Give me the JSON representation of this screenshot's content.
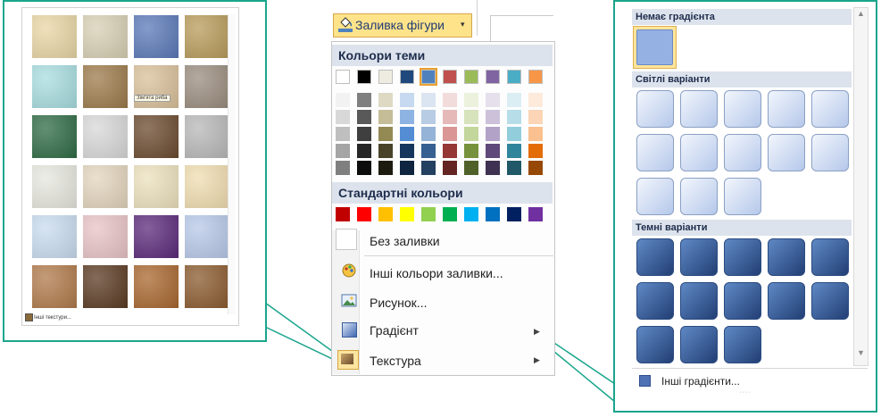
{
  "fill_button": {
    "label": "Заливка фігури",
    "arrow": "▾",
    "icon": "paint-bucket-icon"
  },
  "menu": {
    "theme_colors_header": "Кольори теми",
    "standard_colors_header": "Стандартні кольори",
    "items": [
      {
        "label": "Без заливки",
        "icon": "no-fill-icon",
        "submenu": false
      },
      {
        "label": "Інші кольори заливки...",
        "icon": "palette-icon",
        "submenu": false
      },
      {
        "label": "Рисунок...",
        "icon": "picture-icon",
        "submenu": false
      },
      {
        "label": "Градієнт",
        "icon": "gradient-icon",
        "submenu": true
      },
      {
        "label": "Текстура",
        "icon": "texture-icon",
        "submenu": true
      }
    ],
    "submenu_arrow": "▶",
    "theme_top_row": [
      "#ffffff",
      "#000000",
      "#eeece1",
      "#1f497d",
      "#4f81bd",
      "#c0504d",
      "#9bbb59",
      "#8064a2",
      "#4bacc6",
      "#f79646"
    ],
    "theme_shades": [
      [
        "#f2f2f2",
        "#d8d8d8",
        "#bfbfbf",
        "#a5a5a5",
        "#7f7f7f"
      ],
      [
        "#7f7f7f",
        "#595959",
        "#3f3f3f",
        "#262626",
        "#0c0c0c"
      ],
      [
        "#ddd9c3",
        "#c4bd97",
        "#938953",
        "#494429",
        "#1d1b10"
      ],
      [
        "#c6d9f0",
        "#8db3e2",
        "#548dd4",
        "#17365d",
        "#0f243e"
      ],
      [
        "#dbe5f1",
        "#b8cce4",
        "#95b3d7",
        "#366092",
        "#244061"
      ],
      [
        "#f2dcdb",
        "#e5b9b7",
        "#d99694",
        "#953734",
        "#632423"
      ],
      [
        "#ebf1dd",
        "#d7e3bc",
        "#c3d69b",
        "#76923c",
        "#4f6128"
      ],
      [
        "#e5e0ec",
        "#ccc1d9",
        "#b2a2c7",
        "#5f497a",
        "#3f3151"
      ],
      [
        "#dbeef3",
        "#b7dde8",
        "#92cddc",
        "#31859b",
        "#205867"
      ],
      [
        "#fdeada",
        "#fbd5b5",
        "#fac08f",
        "#e36c09",
        "#974806"
      ]
    ],
    "standard_colors": [
      "#c00000",
      "#ff0000",
      "#ffc000",
      "#ffff00",
      "#92d050",
      "#00b050",
      "#00b0f0",
      "#0070c0",
      "#002060",
      "#7030a0"
    ]
  },
  "texture_panel": {
    "tooltip": "Зім'ята риба",
    "more_label": "Інші текстури...",
    "textures": [
      [
        "#e9d6a5",
        "#d8cfb4",
        "#5a79b8",
        "#b89b5a"
      ],
      [
        "#a8dde0",
        "#9c7a4a",
        "#d9c09a",
        "#9a8c7e"
      ],
      [
        "#2e6b44",
        "#d8d8d8",
        "#6b4a2e",
        "#b8b8b8"
      ],
      [
        "#e7e7df",
        "#e3d5bd",
        "#ece1bd",
        "#f0ddb0"
      ],
      [
        "#c9dcef",
        "#e8c3c6",
        "#5b2a7a",
        "#b7c8e8"
      ],
      [
        "#b07a4a",
        "#5a3a22",
        "#a8672e",
        "#8a5a2e"
      ]
    ]
  },
  "gradient_panel": {
    "no_gradient_header": "Немає градієнта",
    "light_header": "Світлі варіанти",
    "dark_header": "Темні варіанти",
    "more_label": "Інші градієнти...",
    "scroll_up": "▲",
    "scroll_down": "▼",
    "dots": "····"
  }
}
